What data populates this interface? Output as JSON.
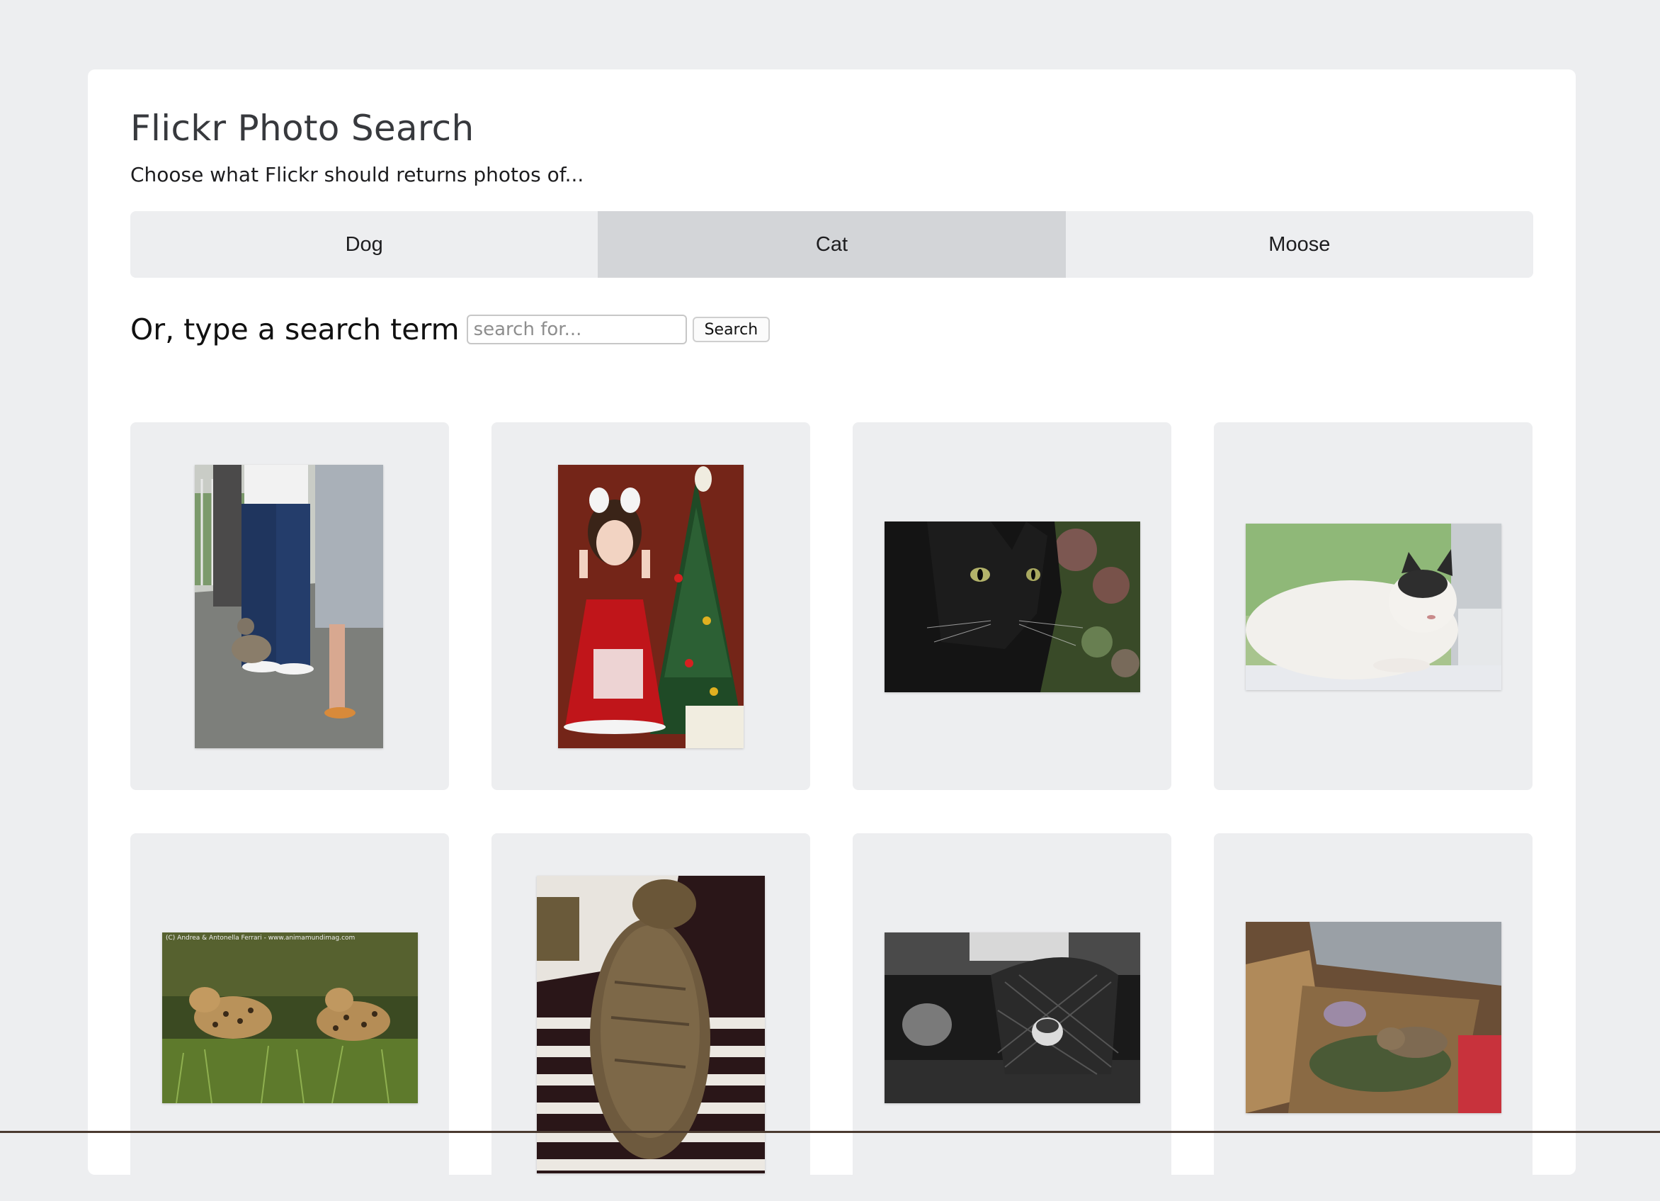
{
  "header": {
    "title": "Flickr Photo Search",
    "subtitle": "Choose what Flickr should returns photos of..."
  },
  "presets": [
    {
      "label": "Dog",
      "active": false
    },
    {
      "label": "Cat",
      "active": true
    },
    {
      "label": "Moose",
      "active": false
    }
  ],
  "search": {
    "label": "Or, type a search term",
    "placeholder": "search for...",
    "button_label": "Search"
  },
  "photos": [
    {
      "subject": "people standing with a cat on a leash",
      "icon": "photo-icon"
    },
    {
      "subject": "girl in red santa costume by christmas tree",
      "icon": "photo-icon"
    },
    {
      "subject": "black cat close-up",
      "icon": "photo-icon"
    },
    {
      "subject": "white cat lying on windowsill",
      "icon": "photo-icon"
    },
    {
      "subject": "two leopards in grass",
      "icon": "photo-icon",
      "watermark": "(C) Andrea & Antonella Ferrari - www.animamundimag.com"
    },
    {
      "subject": "tabby cat on striped blanket",
      "icon": "photo-icon"
    },
    {
      "subject": "black and white cat under wicker chair",
      "icon": "photo-icon"
    },
    {
      "subject": "tabby cat sleeping in cardboard box",
      "icon": "photo-icon"
    }
  ],
  "colors": {
    "page_background": "#edeef0",
    "card_background": "#ffffff",
    "active_preset": "#d3d5d8"
  }
}
